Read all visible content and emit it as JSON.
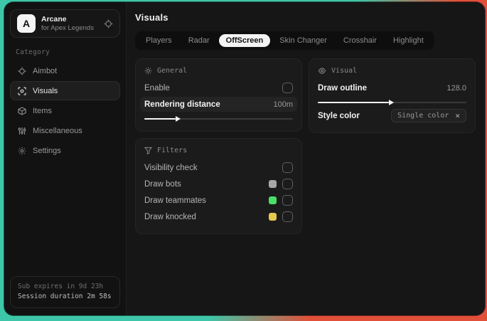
{
  "sidebar": {
    "brand": {
      "logo_letter": "A",
      "name": "Arcane",
      "subtitle": "for Apex Legends"
    },
    "category_label": "Category",
    "items": [
      {
        "label": "Aimbot",
        "icon": "crosshair-icon",
        "active": false
      },
      {
        "label": "Visuals",
        "icon": "scan-eye-icon",
        "active": true
      },
      {
        "label": "Items",
        "icon": "cube-icon",
        "active": false
      },
      {
        "label": "Miscellaneous",
        "icon": "sliders-icon",
        "active": false
      },
      {
        "label": "Settings",
        "icon": "gear-icon",
        "active": false
      }
    ],
    "footer": {
      "sub_expires": "Sub expires in 9d 23h",
      "session_duration": "Session duration 2m 58s"
    }
  },
  "main": {
    "title": "Visuals",
    "tabs": [
      {
        "label": "Players",
        "active": false
      },
      {
        "label": "Radar",
        "active": false
      },
      {
        "label": "OffScreen",
        "active": true
      },
      {
        "label": "Skin Changer",
        "active": false
      },
      {
        "label": "Crosshair",
        "active": false
      },
      {
        "label": "Highlight",
        "active": false
      }
    ],
    "general": {
      "title": "General",
      "enable_label": "Enable",
      "enable_checked": false,
      "rendering_distance_label": "Rendering distance",
      "rendering_distance_value": "100m",
      "rendering_distance_percent": 21
    },
    "filters": {
      "title": "Filters",
      "rows": [
        {
          "label": "Visibility check",
          "checked": false
        },
        {
          "label": "Draw bots",
          "swatch": "#a6a6a6",
          "checked": false
        },
        {
          "label": "Draw teammates",
          "swatch": "#4ade68",
          "checked": false
        },
        {
          "label": "Draw knocked",
          "swatch": "#e5c94f",
          "checked": false
        }
      ]
    },
    "visual": {
      "title": "Visual",
      "draw_outline_label": "Draw outline",
      "draw_outline_value": "128.0",
      "draw_outline_percent": 48,
      "style_color_label": "Style color",
      "style_color_value": "Single color",
      "clear_glyph": "×"
    }
  },
  "colors": {
    "background_teal": "#3ec6a8",
    "background_red": "#e2503a",
    "swatch_bots": "#a6a6a6",
    "swatch_teammates": "#4ade68",
    "swatch_knocked": "#e5c94f"
  }
}
